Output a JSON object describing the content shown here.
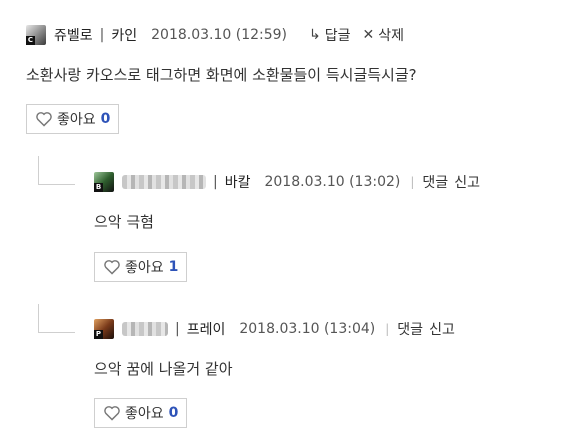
{
  "comments": [
    {
      "nickname": "쥬벨로",
      "board": "카인",
      "date": "2018.03.10 (12:59)",
      "actions": {
        "reply": "답글",
        "delete": "삭제"
      },
      "body": "소환사랑 카오스로 태그하면 화면에 소환물들이 득시글득시글?",
      "like": {
        "label": "좋아요",
        "count": "0"
      },
      "avatar": {
        "badge": "C",
        "color": "#2a2a2a"
      }
    },
    {
      "board": "바칼",
      "date": "2018.03.10 (13:02)",
      "actions": {
        "reply": "댓글",
        "report": "신고"
      },
      "body": "으악 극혐",
      "like": {
        "label": "좋아요",
        "count": "1"
      },
      "avatar": {
        "badge": "B",
        "color": "#3b6f3a"
      }
    },
    {
      "board": "프레이",
      "date": "2018.03.10 (13:04)",
      "actions": {
        "reply": "댓글",
        "report": "신고"
      },
      "body": "으악 꿈에 나올거 같아",
      "like": {
        "label": "좋아요",
        "count": "0"
      },
      "avatar": {
        "badge": "P",
        "color": "#8a4b2a"
      }
    }
  ],
  "colors": {
    "like_count": "#2e53b8",
    "border": "#cfcfcf",
    "text": "#333333"
  },
  "icons": [
    "reply-arrow-icon",
    "close-icon",
    "heart-icon"
  ]
}
